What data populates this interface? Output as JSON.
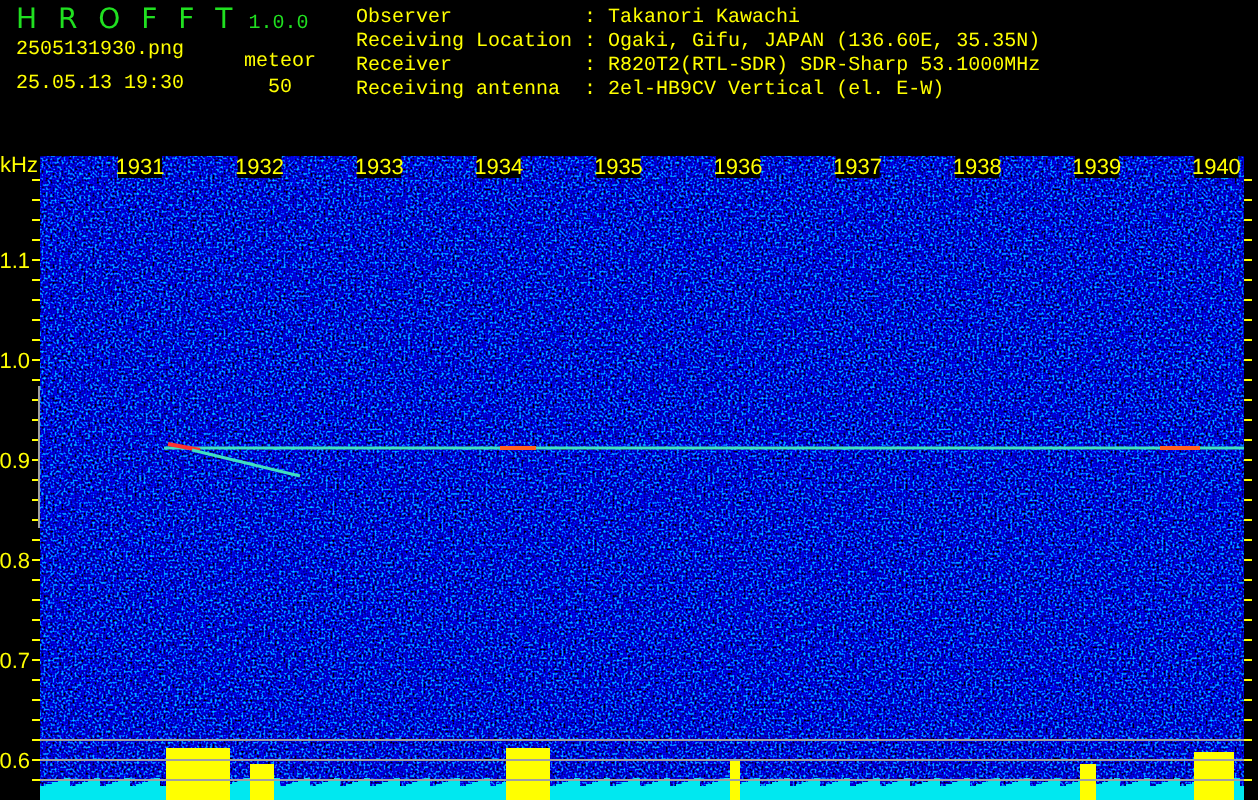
{
  "app": {
    "name": "H R O F F T",
    "version": "1.0.0"
  },
  "file": {
    "name": "2505131930.png",
    "timestamp": "25.05.13 19:30"
  },
  "detection": {
    "label": "meteor",
    "count": "50"
  },
  "station_info": [
    {
      "label": "Observer",
      "separator": ":",
      "value": "Takanori Kawachi"
    },
    {
      "label": "Receiving Location",
      "separator": ":",
      "value": "Ogaki, Gifu, JAPAN (136.60E, 35.35N)"
    },
    {
      "label": "Receiver",
      "separator": ":",
      "value": "R820T2(RTL-SDR) SDR-Sharp 53.1000MHz"
    },
    {
      "label": "Receiving antenna",
      "separator": ":",
      "value": "2el-HB9CV Vertical (el. E-W)"
    }
  ],
  "spectrogram": {
    "unit": "kHz",
    "y_ticks": [
      "1.1",
      "1.0",
      "0.9",
      "0.8",
      "0.7",
      "0.6"
    ],
    "x_ticks": [
      "1931",
      "1932",
      "1933",
      "1934",
      "1935",
      "1936",
      "1937",
      "1938",
      "1939",
      "1940"
    ]
  }
}
